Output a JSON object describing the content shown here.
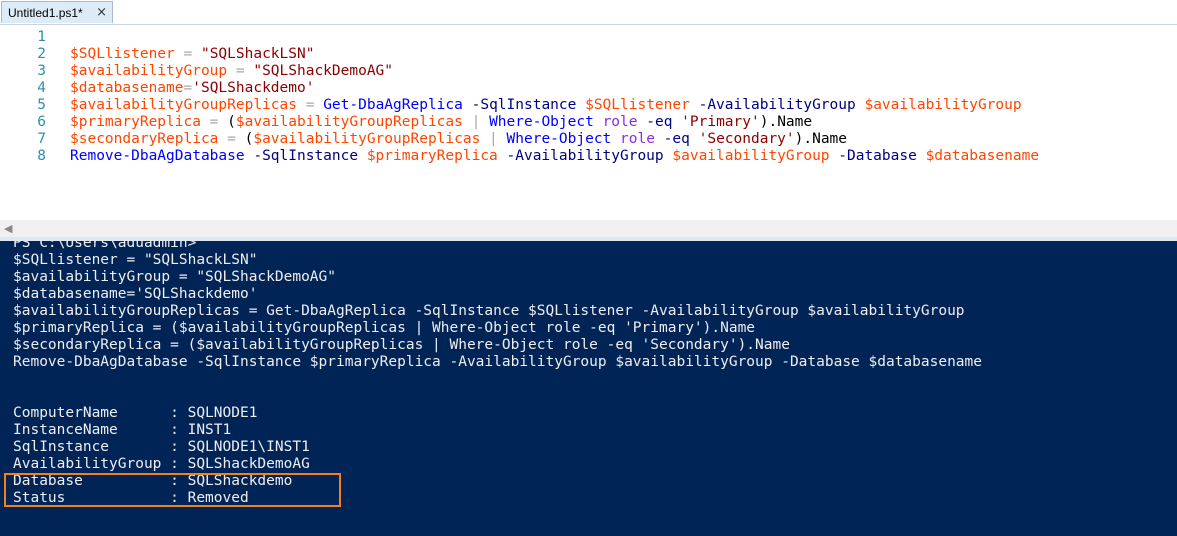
{
  "tab": {
    "title": "Untitled1.ps1*",
    "close_glyph": "×"
  },
  "editor": {
    "line_numbers": [
      "1",
      "2",
      "3",
      "4",
      "5",
      "6",
      "7",
      "8"
    ],
    "lines": [
      [],
      [
        {
          "t": "$SQLlistener",
          "c": "var"
        },
        {
          "t": " = ",
          "c": "op"
        },
        {
          "t": "\"SQLShackLSN\"",
          "c": "str"
        }
      ],
      [
        {
          "t": "$availabilityGroup",
          "c": "var"
        },
        {
          "t": " = ",
          "c": "op"
        },
        {
          "t": "\"SQLShackDemoAG\"",
          "c": "str"
        }
      ],
      [
        {
          "t": "$databasename",
          "c": "var"
        },
        {
          "t": "=",
          "c": "op"
        },
        {
          "t": "'SQLShackdemo'",
          "c": "str"
        }
      ],
      [
        {
          "t": "$availabilityGroupReplicas",
          "c": "var"
        },
        {
          "t": " = ",
          "c": "op"
        },
        {
          "t": "Get-DbaAgReplica",
          "c": "cmd"
        },
        {
          "t": " -SqlInstance ",
          "c": "param"
        },
        {
          "t": "$SQLlistener",
          "c": "var"
        },
        {
          "t": " -AvailabilityGroup ",
          "c": "param"
        },
        {
          "t": "$availabilityGroup",
          "c": "var"
        }
      ],
      [
        {
          "t": "$primaryReplica",
          "c": "var"
        },
        {
          "t": " = ",
          "c": "op"
        },
        {
          "t": "(",
          "c": "plain"
        },
        {
          "t": "$availabilityGroupReplicas",
          "c": "var"
        },
        {
          "t": " | ",
          "c": "op"
        },
        {
          "t": "Where-Object",
          "c": "cmd"
        },
        {
          "t": " ",
          "c": "plain"
        },
        {
          "t": "role",
          "c": "arg"
        },
        {
          "t": " -eq ",
          "c": "param"
        },
        {
          "t": "'Primary'",
          "c": "str"
        },
        {
          "t": ").Name",
          "c": "plain"
        }
      ],
      [
        {
          "t": "$secondaryReplica",
          "c": "var"
        },
        {
          "t": " = ",
          "c": "op"
        },
        {
          "t": "(",
          "c": "plain"
        },
        {
          "t": "$availabilityGroupReplicas",
          "c": "var"
        },
        {
          "t": " | ",
          "c": "op"
        },
        {
          "t": "Where-Object",
          "c": "cmd"
        },
        {
          "t": " ",
          "c": "plain"
        },
        {
          "t": "role",
          "c": "arg"
        },
        {
          "t": " -eq ",
          "c": "param"
        },
        {
          "t": "'Secondary'",
          "c": "str"
        },
        {
          "t": ").Name",
          "c": "plain"
        }
      ],
      [
        {
          "t": "Remove-DbaAgDatabase",
          "c": "cmd"
        },
        {
          "t": " -SqlInstance ",
          "c": "param"
        },
        {
          "t": "$primaryReplica",
          "c": "var"
        },
        {
          "t": " -AvailabilityGroup ",
          "c": "param"
        },
        {
          "t": "$availabilityGroup",
          "c": "var"
        },
        {
          "t": " -Database ",
          "c": "param"
        },
        {
          "t": "$databasename",
          "c": "var"
        }
      ]
    ]
  },
  "scrollbar": {
    "left_arrow": "◀"
  },
  "console": {
    "lines": [
      "PS C:\\Users\\aduadmin>",
      "$SQLlistener = \"SQLShackLSN\"",
      "$availabilityGroup = \"SQLShackDemoAG\"",
      "$databasename='SQLShackdemo'",
      "$availabilityGroupReplicas = Get-DbaAgReplica -SqlInstance $SQLlistener -AvailabilityGroup $availabilityGroup",
      "$primaryReplica = ($availabilityGroupReplicas | Where-Object role -eq 'Primary').Name",
      "$secondaryReplica = ($availabilityGroupReplicas | Where-Object role -eq 'Secondary').Name",
      "Remove-DbaAgDatabase -SqlInstance $primaryReplica -AvailabilityGroup $availabilityGroup -Database $databasename",
      "",
      "",
      "ComputerName      : SQLNODE1",
      "InstanceName      : INST1",
      "SqlInstance       : SQLNODE1\\INST1",
      "AvailabilityGroup : SQLShackDemoAG",
      "Database          : SQLShackdemo",
      "Status            : Removed"
    ]
  },
  "colors": {
    "console_bg": "#012456",
    "console_fg": "#eeedf0",
    "highlight": "#f0821e",
    "variable": "#ff4500",
    "string": "#8b0000",
    "command": "#0000ff",
    "parameter": "#000080"
  }
}
